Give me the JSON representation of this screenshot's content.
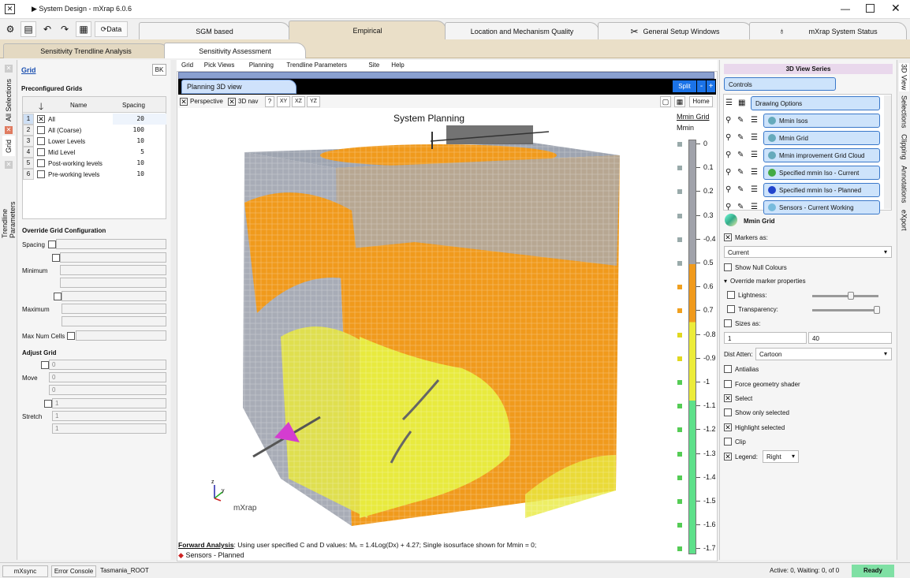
{
  "window": {
    "title": "System Design - mXrap 6.0.6"
  },
  "toolbar": {
    "data_label": "Data"
  },
  "main_tabs": [
    "SGM based",
    "Empirical",
    "Location and Mechanism Quality",
    "General Setup Windows",
    "mXrap System Status"
  ],
  "sub_tabs": [
    "Sensitivity Trendline Analysis",
    "Sensitivity Assessment"
  ],
  "left_vtabs": [
    "All Selections",
    "Grid",
    "Trendline Parameters"
  ],
  "grid_panel": {
    "title": "Grid",
    "bk": "BK",
    "preconfigured": "Preconfigured Grids",
    "columns": [
      "Name",
      "Spacing"
    ],
    "rows": [
      {
        "idx": "1",
        "name": "All",
        "spacing": "20",
        "checked": "✕"
      },
      {
        "idx": "2",
        "name": "All (Coarse)",
        "spacing": "100",
        "checked": ""
      },
      {
        "idx": "3",
        "name": "Lower Levels",
        "spacing": "10",
        "checked": ""
      },
      {
        "idx": "4",
        "name": "Mid Level",
        "spacing": "5",
        "checked": ""
      },
      {
        "idx": "5",
        "name": "Post-working levels",
        "spacing": "10",
        "checked": ""
      },
      {
        "idx": "6",
        "name": "Pre-working levels",
        "spacing": "10",
        "checked": ""
      }
    ],
    "override_title": "Override Grid Configuration",
    "spacing": "Spacing",
    "minimum": "Minimum",
    "maximum": "Maximum",
    "max_cells": "Max Num Cells",
    "adjust_title": "Adjust Grid",
    "move": "Move",
    "stretch": "Stretch",
    "move_vals": [
      "0",
      "0",
      "0"
    ],
    "stretch_vals": [
      "1",
      "1",
      "1"
    ]
  },
  "menu": [
    "Grid",
    "Pick Views",
    "Planning",
    "Trendline Parameters",
    "Site",
    "Help"
  ],
  "view": {
    "tab": "Planning 3D view",
    "split": "Split",
    "perspective": "Perspective",
    "nav": "3D nav",
    "help": "?",
    "xy": "XY",
    "xz": "XZ",
    "yz": "YZ",
    "home": "Home",
    "title": "System Planning",
    "logo": "mXrap",
    "forward_bold": "Forward Analysis",
    "forward_text": ": Using user specified C and D values: Mₖ = 1.4Log(Dx) + 4.27; Single isosurface shown for Mmin = 0;",
    "legend_item": "Sensors - Planned",
    "cbar_title": "Mmin Grid",
    "cbar_sub": "Mmin",
    "cbar_ticks": [
      "0",
      "0.1",
      "0.2",
      "0.3",
      "-0.4",
      "0.5",
      "0.6",
      "0.7",
      "-0.8",
      "-0.9",
      "-1",
      "-1.1",
      "-1.2",
      "-1.3",
      "-1.4",
      "-1.5",
      "-1.6",
      "-1.7"
    ]
  },
  "right": {
    "header": "3D View Series",
    "controls": "Controls",
    "series": [
      "Drawing Options",
      "Mmin Isos",
      "Mmin Grid",
      "Mmin improvement Grid Cloud",
      "Specified mmin Iso - Current",
      "Specified mmin Iso - Planned",
      "Sensors - Current Working"
    ],
    "selected": "Mmin Grid",
    "markers_as": "Markers as:",
    "current": "Current",
    "show_null": "Show Null Colours",
    "override_marker": "Override marker properties",
    "lightness": "Lightness:",
    "transparency": "Transparency:",
    "sizes_as": "Sizes as:",
    "size1": "1",
    "size2": "40",
    "dist_atten": "Dist Atten:",
    "cartoon": "Cartoon",
    "antialias": "Antialias",
    "force_geom": "Force geometry shader",
    "select": "Select",
    "show_only": "Show only selected",
    "highlight": "Highlight selected",
    "clip": "Clip",
    "legend": "Legend:",
    "legend_val": "Right",
    "vtabs": [
      "3D View",
      "Selections",
      "Clipping",
      "Annotations",
      "eXport"
    ]
  },
  "status": {
    "mxsync": "mXsync",
    "console": "Error Console",
    "root": "Tasmania_ROOT",
    "active": "Active: 0, Waiting: 0, of 0",
    "ready": "Ready"
  }
}
